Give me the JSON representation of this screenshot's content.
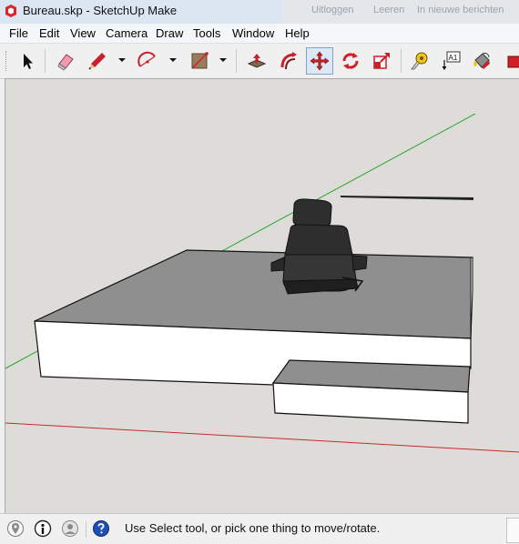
{
  "window": {
    "title": "Bureau.skp - SketchUp Make",
    "background_text": [
      "Uitloggen",
      "Leeren",
      "In nieuwe berichten"
    ]
  },
  "menu": {
    "items": [
      "File",
      "Edit",
      "View",
      "Camera",
      "Draw",
      "Tools",
      "Window",
      "Help"
    ]
  },
  "toolbar": {
    "tools": [
      {
        "name": "select-tool",
        "icon": "arrow-cursor-icon",
        "active": false
      },
      {
        "name": "eraser-tool",
        "icon": "eraser-icon",
        "active": false
      },
      {
        "name": "line-tool",
        "icon": "pencil-icon",
        "active": false
      },
      {
        "name": "arc-tool",
        "icon": "arc-icon",
        "active": false
      },
      {
        "name": "rectangle-tool",
        "icon": "rectangle-icon",
        "active": false
      },
      {
        "name": "push-pull-tool",
        "icon": "push-pull-icon",
        "active": false
      },
      {
        "name": "follow-me-tool",
        "icon": "follow-me-icon",
        "active": false
      },
      {
        "name": "move-tool",
        "icon": "move-arrows-icon",
        "active": true
      },
      {
        "name": "rotate-tool",
        "icon": "rotate-icon",
        "active": false
      },
      {
        "name": "scale-tool",
        "icon": "scale-icon",
        "active": false
      },
      {
        "name": "tape-measure-tool",
        "icon": "tape-measure-icon",
        "active": false
      },
      {
        "name": "text-tool",
        "icon": "text-label-icon",
        "active": false
      },
      {
        "name": "paint-bucket-tool",
        "icon": "paint-bucket-icon",
        "active": false
      }
    ],
    "text_tool_label": "A1"
  },
  "colors": {
    "viewport_bg": "#dedcd9",
    "green_axis": "#2aa52a",
    "red_axis": "#c0302a",
    "top_face": "#8f8f8f",
    "side_face": "#ffffff",
    "chair": "#2e2e2e",
    "accent_blue": "#1f4fb3"
  },
  "status": {
    "message": "Use Select tool, or pick one thing to move/rotate."
  }
}
